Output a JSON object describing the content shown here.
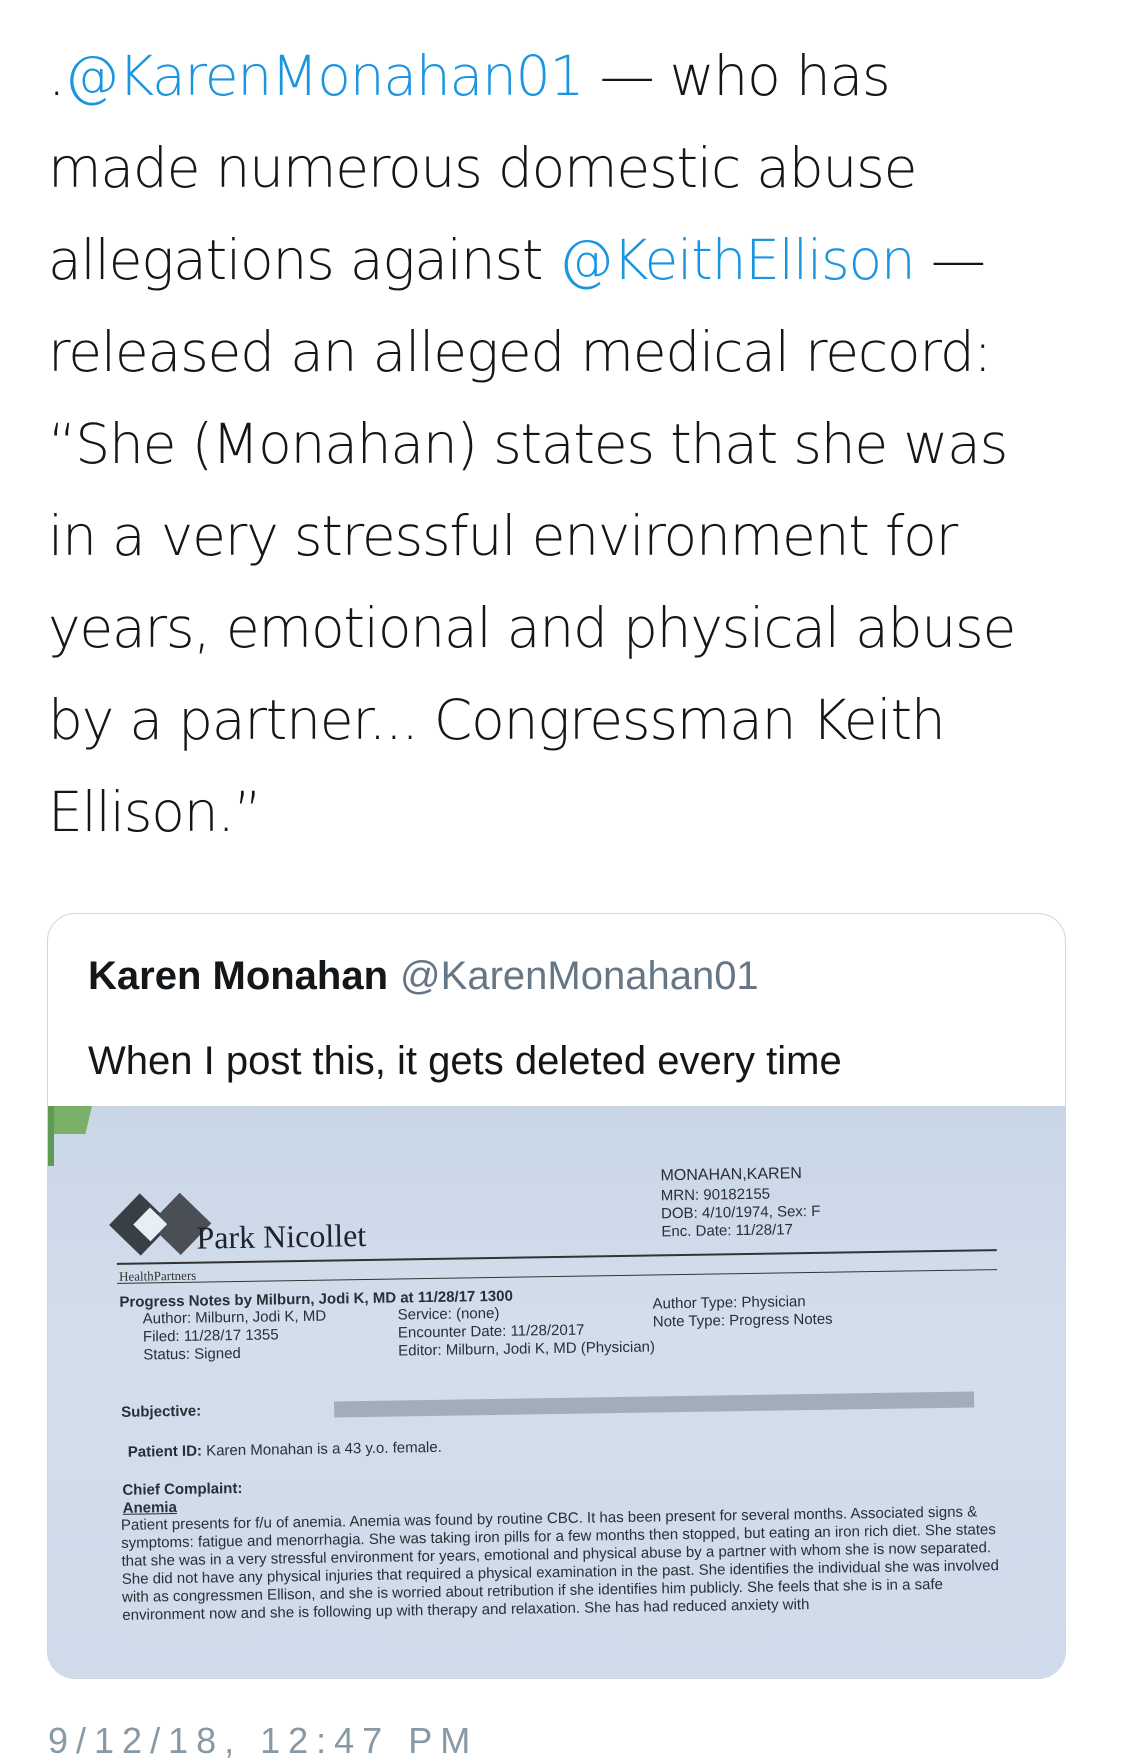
{
  "tweet": {
    "line1_prefix": ".",
    "mention_karen": "@KarenMonahan01",
    "line1_suffix": " — who has",
    "line2": "made numerous domestic abuse",
    "line3_prefix": "allegations against ",
    "mention_keith": "@KeithEllison",
    "line3_suffix": " —",
    "line4": "released an alleged medical record:",
    "line5": "“She (Monahan) states that she was",
    "line6": "in a very stressful environment for",
    "line7": "years, emotional and physical abuse",
    "line8": "by a partner... Congressman Keith",
    "line9": "Ellison.”",
    "timestamp": "9/12/18, 12:47 PM"
  },
  "quote": {
    "name": "Karen Monahan",
    "handle": "@KarenMonahan01",
    "text": "When I post this, it gets deleted every time"
  },
  "document": {
    "org": "Park Nicollet",
    "org_sub": "HealthPartners",
    "patient_name": "MONAHAN,KAREN",
    "mrn": "MRN: 90182155",
    "dob": "DOB: 4/10/1974, Sex: F",
    "enc_date": "Enc. Date: 11/28/17",
    "notes_title": "Progress Notes by Milburn, Jodi K, MD at 11/28/17 1300",
    "author": "Author:  Milburn, Jodi K, MD",
    "filed": "Filed:  11/28/17 1355",
    "status": "Status:  Signed",
    "service": "Service:  (none)",
    "encounter_date": "Encounter Date:  11/28/2017",
    "editor": "Editor:  Milburn, Jodi K, MD (Physician)",
    "author_type": "Author Type:  Physician",
    "note_type": "Note Type:  Progress Notes",
    "subjective": "Subjective:",
    "patient_id_label": "Patient ID:",
    "patient_id_text": " Karen Monahan is a 43 y.o. female.",
    "chief_complaint": "Chief Complaint:",
    "anemia": "Anemia",
    "body": "Patient presents for f/u of anemia. Anemia was found by routine CBC. It has been present for several months. Associated signs & symptoms: fatigue and menorrhagia. She was taking iron pills for a few months then stopped, but eating an iron rich diet. She states that she was in a very stressful environment for years, emotional and physical abuse by a partner with whom she is now separated. She did not have any physical injuries that required a physical examination in the past. She identifies the individual she was involved with as congressmen Ellison, and she is worried about retribution if she identifies him publicly. She feels that she is in a safe environment now and she is following up with therapy and relaxation. She has had reduced anxiety with"
  }
}
